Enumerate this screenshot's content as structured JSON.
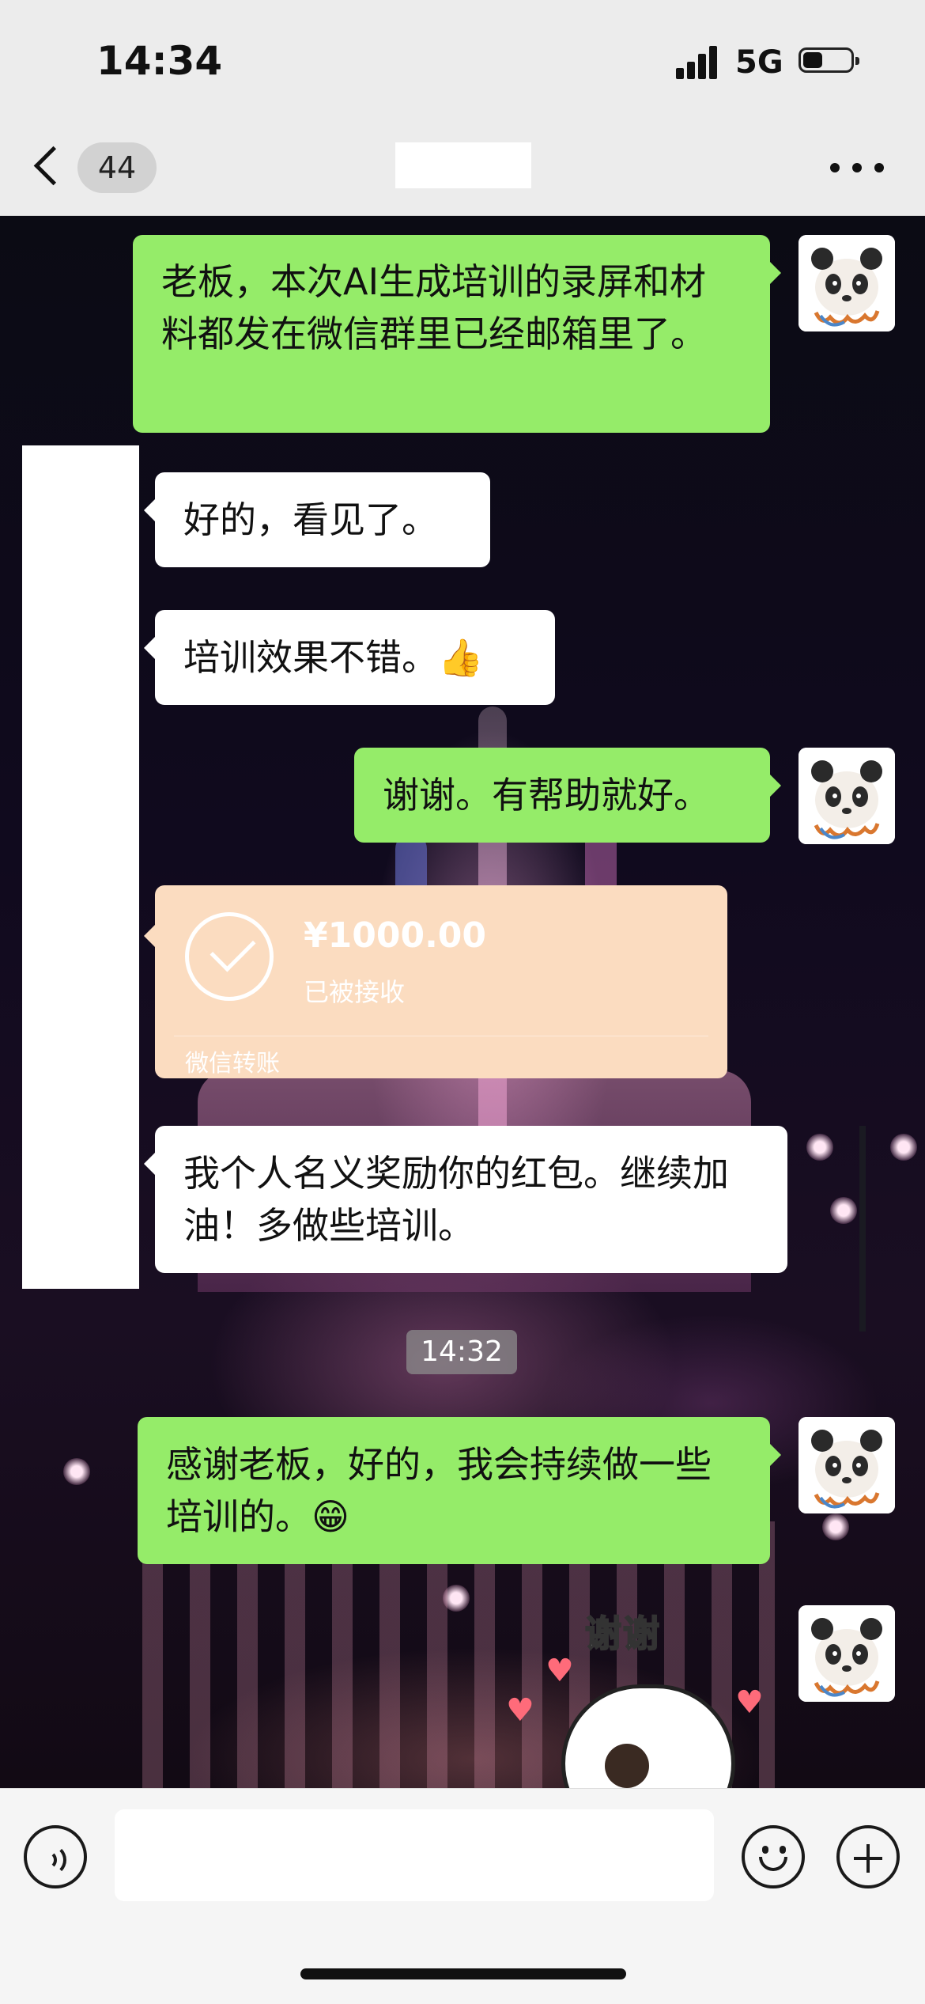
{
  "status_bar": {
    "time": "14:34",
    "network": "5G"
  },
  "nav": {
    "unread_count": "44"
  },
  "messages": [
    {
      "side": "me",
      "text": "老板，本次AI生成培训的录屏和材料都发在微信群里已经邮箱里了。"
    },
    {
      "side": "them",
      "text": "好的，看见了。"
    },
    {
      "side": "them",
      "text": "培训效果不错。",
      "emoji": "👍"
    },
    {
      "side": "me",
      "text": "谢谢。有帮助就好。"
    },
    {
      "side": "them",
      "text": "我个人名义奖励你的红包。继续加油！多做些培训。"
    },
    {
      "side": "me",
      "text": "感谢老板，好的，我会持续做一些培训的。",
      "emoji": "😁"
    }
  ],
  "transfer": {
    "amount": "¥1000.00",
    "status": "已被接收",
    "label": "微信转账"
  },
  "timestamp": "14:32",
  "sticker": {
    "text": "谢谢"
  },
  "input": {
    "placeholder": ""
  },
  "colors": {
    "bubble_me": "#95ec69",
    "bubble_them": "#ffffff",
    "transfer_card": "#fbdcc0",
    "nav_bg": "#ececec"
  }
}
